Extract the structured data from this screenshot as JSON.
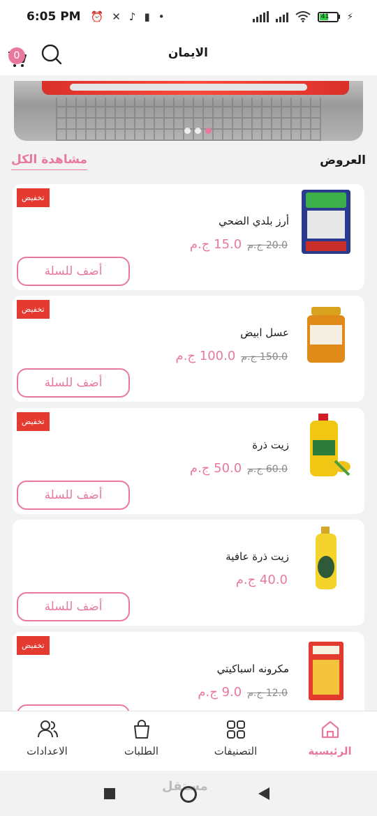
{
  "status_bar": {
    "time": "6:05 PM",
    "battery": "41"
  },
  "header": {
    "title": "الايمان",
    "cart_count": "0"
  },
  "offers": {
    "title": "العروض",
    "see_all": "مشاهدة الكل"
  },
  "products": [
    {
      "name": "أرز بلدي الضحي",
      "old_price": "20.0 ج.م",
      "new_price": "15.0 ج.م",
      "badge": "تخفيض",
      "button": "أضف للسلة",
      "thumb": "rice-bag"
    },
    {
      "name": "عسل ابيض",
      "old_price": "150.0 ج.م",
      "new_price": "100.0 ج.م",
      "badge": "تخفيض",
      "button": "أضف للسلة",
      "thumb": "honey-jar"
    },
    {
      "name": "زيت ذرة",
      "old_price": "60.0 ج.م",
      "new_price": "50.0 ج.م",
      "badge": "تخفيض",
      "button": "أضف للسلة",
      "thumb": "oil-bottle"
    },
    {
      "name": "زيت ذرة عافية",
      "old_price": "",
      "new_price": "40.0 ج.م",
      "badge": "",
      "button": "أضف للسلة",
      "thumb": "oil-bottle-small"
    },
    {
      "name": "مكرونه اسباكيتي",
      "old_price": "12.0 ج.م",
      "new_price": "9.0 ج.م",
      "badge": "تخفيض",
      "button": "أضف للسلة",
      "thumb": "pasta-pack"
    }
  ],
  "nav": {
    "home": "الرئيسية",
    "categories": "التصنيفات",
    "orders": "الطلبات",
    "settings": "الاعدادات"
  },
  "watermark": "مستقل",
  "colors": {
    "accent": "#e8799c",
    "badge": "#e53a2f"
  }
}
